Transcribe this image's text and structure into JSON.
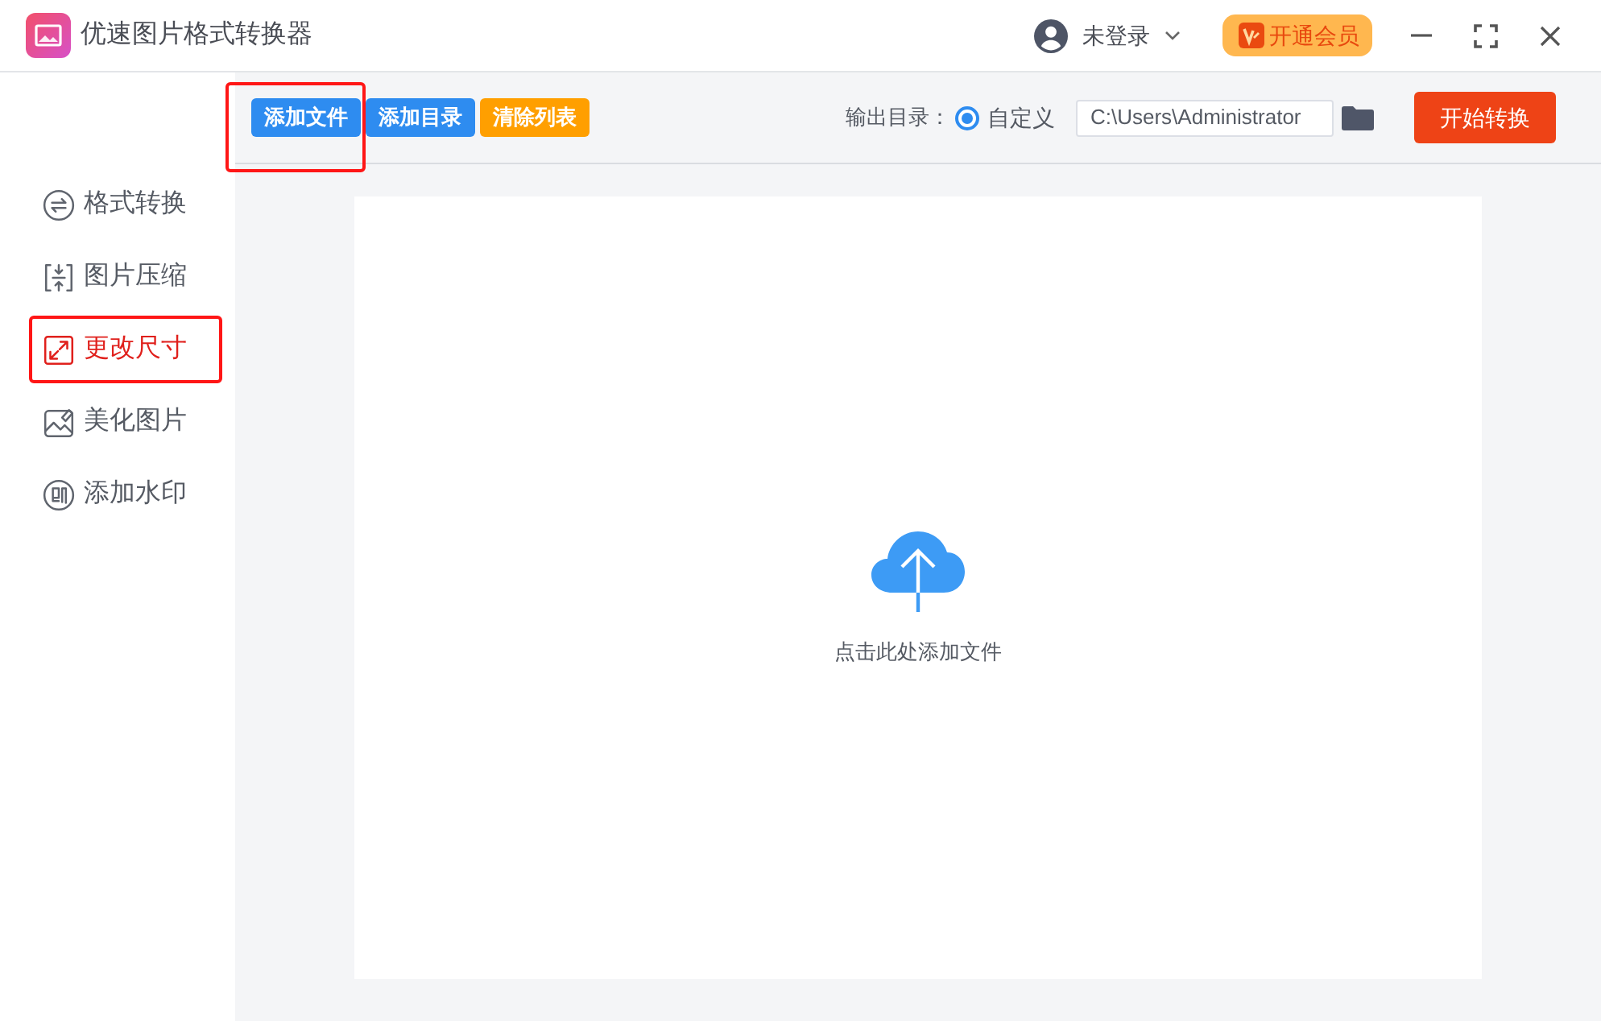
{
  "window": {
    "title": "优速图片格式转换器",
    "user_label": "未登录",
    "vip_button": "开通会员"
  },
  "toolbar": {
    "buttons": [
      {
        "label": "添加文件",
        "kind": "primary",
        "highlighted": true
      },
      {
        "label": "添加目录",
        "kind": "primary",
        "highlighted": false
      },
      {
        "label": "清除列表",
        "kind": "warning",
        "highlighted": false
      }
    ],
    "output": {
      "label": "输出目录：",
      "option": {
        "label": "自定义",
        "selected": true
      },
      "path": "C:\\Users\\Administrator"
    },
    "start_button": "开始转换"
  },
  "sidebar": {
    "items": [
      {
        "label": "格式转换",
        "selected": false,
        "highlighted": false
      },
      {
        "label": "图片压缩",
        "selected": false,
        "highlighted": false
      },
      {
        "label": "更改尺寸",
        "selected": true,
        "highlighted": true
      },
      {
        "label": "美化图片",
        "selected": false,
        "highlighted": false
      },
      {
        "label": "添加水印",
        "selected": false,
        "highlighted": false
      }
    ]
  },
  "drop_zone": {
    "hint": "点击此处添加文件"
  }
}
